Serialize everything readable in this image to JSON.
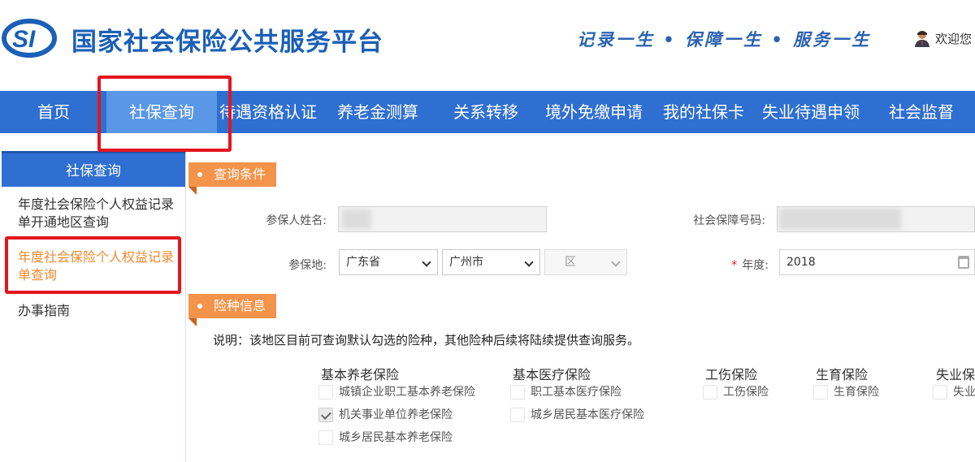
{
  "header": {
    "logo_text": "SI",
    "title": "国家社会保险公共服务平台",
    "slogan": "记录一生 • 保障一生 • 服务一生",
    "welcome": "欢迎您"
  },
  "nav": {
    "items": [
      {
        "label": "首页"
      },
      {
        "label": "社保查询",
        "active": true
      },
      {
        "label": "待遇资格认证"
      },
      {
        "label": "养老金测算"
      },
      {
        "label": "关系转移"
      },
      {
        "label": "境外免缴申请"
      },
      {
        "label": "我的社保卡"
      },
      {
        "label": "失业待遇申领"
      },
      {
        "label": "社会监督"
      }
    ]
  },
  "sidebar": {
    "title": "社保查询",
    "items": [
      {
        "label": "年度社会保险个人权益记录单开通地区查询"
      },
      {
        "label": "年度社会保险个人权益记录单查询",
        "active": true
      },
      {
        "label": "办事指南"
      }
    ]
  },
  "query": {
    "section_title": "查询条件",
    "name_label": "参保人姓名:",
    "ssn_label": "社会保障号码:",
    "location_label": "参保地:",
    "province": "广东省",
    "city": "广州市",
    "district": "区",
    "year_required": "*",
    "year_label": "年度:",
    "year_value": "2018"
  },
  "insurance": {
    "section_title": "险种信息",
    "note": "说明：该地区目前可查询默认勾选的险种，其他险种后续将陆续提供查询服务。",
    "categories": [
      {
        "title": "基本养老保险",
        "options": [
          {
            "label": "城镇企业职工基本养老保险",
            "checked": false
          },
          {
            "label": "机关事业单位养老保险",
            "checked": true
          },
          {
            "label": "城乡居民基本养老保险",
            "checked": false
          }
        ]
      },
      {
        "title": "基本医疗保险",
        "options": [
          {
            "label": "职工基本医疗保险",
            "checked": false
          },
          {
            "label": "城乡居民基本医疗保险",
            "checked": false
          }
        ]
      },
      {
        "title": "工伤保险",
        "options": [
          {
            "label": "工伤保险",
            "checked": false
          }
        ]
      },
      {
        "title": "生育保险",
        "options": [
          {
            "label": "生育保险",
            "checked": false
          }
        ]
      },
      {
        "title": "失业保险",
        "options": [
          {
            "label": "失业保险",
            "checked": false
          }
        ]
      }
    ]
  },
  "colors": {
    "brand_blue": "#2f6fd2",
    "active_tab": "#5a97e6",
    "tag_orange": "#f4934a",
    "highlight_red": "#e3161e",
    "active_link": "#f08a2c"
  }
}
